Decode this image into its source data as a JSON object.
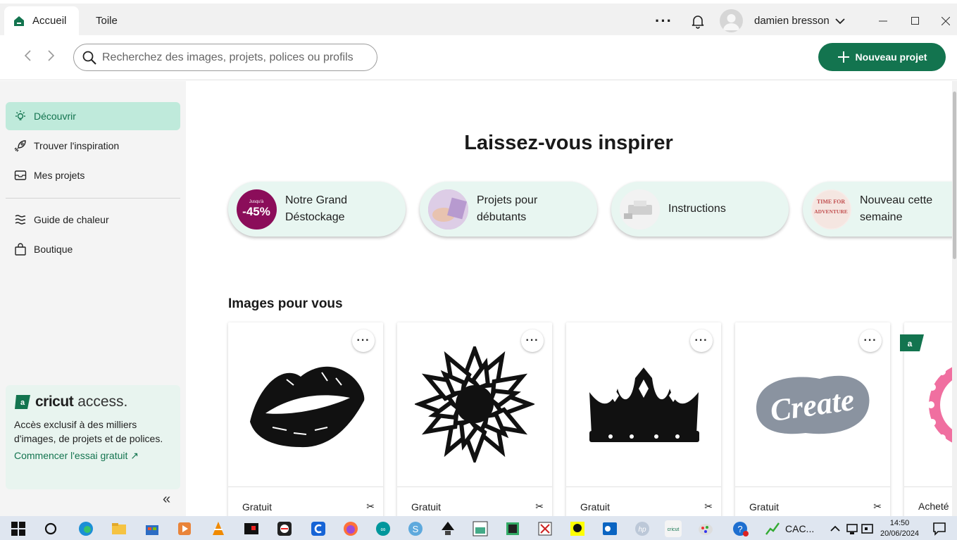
{
  "tabs": [
    {
      "label": "Accueil",
      "active": true
    },
    {
      "label": "Toile",
      "active": false
    }
  ],
  "user": {
    "name": "damien bresson"
  },
  "search": {
    "placeholder": "Recherchez des images, projets, polices ou profils"
  },
  "new_project_label": "Nouveau projet",
  "sidebar": {
    "items": [
      {
        "label": "Découvrir",
        "icon": "lightbulb-icon",
        "active": true
      },
      {
        "label": "Trouver l'inspiration",
        "icon": "rocket-icon"
      },
      {
        "label": "Mes projets",
        "icon": "inbox-icon"
      },
      {
        "label": "Guide de chaleur",
        "icon": "heat-icon"
      },
      {
        "label": "Boutique",
        "icon": "bag-icon"
      }
    ],
    "access": {
      "brand": "cricut",
      "brand_suffix": "access.",
      "description": "Accès exclusif à des milliers d'images, de projets et de polices.",
      "cta": "Commencer l'essai gratuit ↗"
    },
    "collapse": "«"
  },
  "main": {
    "heading": "Laissez-vous inspirer",
    "pills": [
      {
        "label": "Notre Grand Déstockage",
        "badge_small": "Jusqu'à",
        "badge": "-45%"
      },
      {
        "label": "Projets pour débutants"
      },
      {
        "label": "Instructions"
      },
      {
        "label": "Nouveau cette semaine",
        "badge_small": "TIME FOR",
        "badge": "ADVENTURE"
      }
    ],
    "images_title": "Images pour vous",
    "cards": [
      {
        "image": "lips",
        "price": "Gratuit"
      },
      {
        "image": "sunflower",
        "price": "Gratuit"
      },
      {
        "image": "crown",
        "price": "Gratuit"
      },
      {
        "image": "create-lettering",
        "price": "Gratuit",
        "lettering": "Create"
      },
      {
        "image": "pink-flower",
        "price": "Acheté"
      }
    ]
  },
  "taskbar": {
    "app_label": "CAC...",
    "time": "14:50",
    "date": "20/06/2024"
  },
  "colors": {
    "brand": "#13744f",
    "active_bg": "#bfeadb",
    "pill_bg": "#e8f6f1"
  }
}
